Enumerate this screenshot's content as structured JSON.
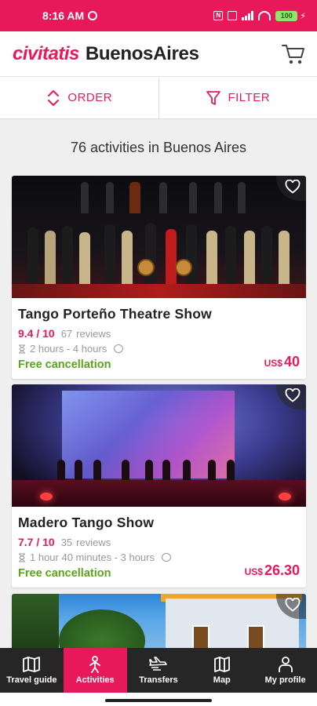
{
  "status_bar": {
    "time": "8:16 AM",
    "battery": "100",
    "sim_label": "N"
  },
  "header": {
    "brand": "civitatis",
    "city": "BuenosAires"
  },
  "toolbar": {
    "order_label": "ORDER",
    "filter_label": "FILTER"
  },
  "results": {
    "count_text": "76 activities in Buenos Aires"
  },
  "activities": [
    {
      "title": "Tango Porteño Theatre Show",
      "rating": "9.4 / 10",
      "reviews_count": "67",
      "reviews_label": "reviews",
      "duration": "2 hours - 4 hours",
      "cancellation": "Free cancellation",
      "currency": "US$",
      "price": "40"
    },
    {
      "title": "Madero Tango Show",
      "rating": "7.7 / 10",
      "reviews_count": "35",
      "reviews_label": "reviews",
      "duration": "1 hour 40 minutes - 3 hours",
      "cancellation": "Free cancellation",
      "currency": "US$",
      "price": "26.30"
    }
  ],
  "bottom_nav": [
    {
      "label": "Travel guide",
      "icon": "book-map-icon"
    },
    {
      "label": "Activities",
      "icon": "person-icon",
      "active": true
    },
    {
      "label": "Transfers",
      "icon": "plane-icon"
    },
    {
      "label": "Map",
      "icon": "map-icon"
    },
    {
      "label": "My profile",
      "icon": "user-icon"
    }
  ],
  "colors": {
    "brand": "#e8195a",
    "free_cancellation": "#5aa31e",
    "nav_background": "#262626"
  }
}
